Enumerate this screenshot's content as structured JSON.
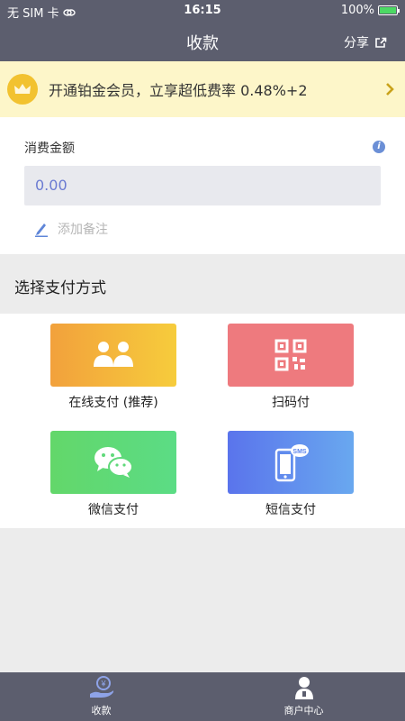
{
  "status": {
    "carrier": "无 SIM 卡",
    "time": "16:15",
    "battery": "100%"
  },
  "nav": {
    "title": "收款",
    "share_label": "分享"
  },
  "vip": {
    "text": "开通铂金会员，立享超低费率 0.48%+2"
  },
  "amount": {
    "label": "消费金额",
    "value": "0.00",
    "remark": "添加备注"
  },
  "section_title": "选择支付方式",
  "payment_methods": [
    {
      "label": "在线支付 (推荐)",
      "icon": "users-icon"
    },
    {
      "label": "扫码付",
      "icon": "qr-code-icon"
    },
    {
      "label": "微信支付",
      "icon": "wechat-icon"
    },
    {
      "label": "短信支付",
      "icon": "sms-phone-icon"
    }
  ],
  "tabs": [
    {
      "label": "收款",
      "icon": "hand-coin-icon"
    },
    {
      "label": "商户中心",
      "icon": "merchant-icon"
    }
  ],
  "colors": {
    "bar": "#5c5e6e",
    "vip_bg": "#fdf6c9",
    "accent": "#6b7bd2"
  }
}
